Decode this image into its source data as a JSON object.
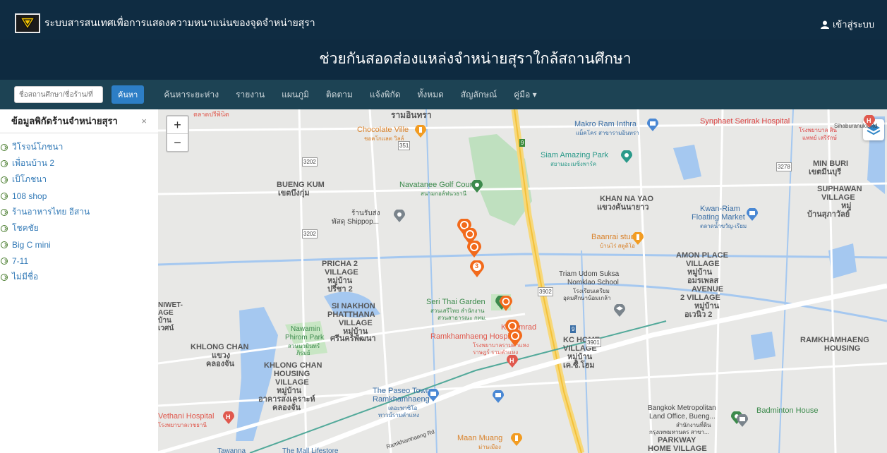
{
  "header": {
    "site_title": "ระบบสารสนเทศเพื่อการแสดงความหนาแน่นของจุดจำหน่ายสุรา",
    "login_label": "เข้าสู่ระบบ",
    "hero_text": "ช่วยกันสอดส่องแหล่งจำหน่ายสุราใกล้สถานศึกษา"
  },
  "navbar": {
    "search_placeholder": "ชื่อสถานศึกษา/ชื่อร้าน/ที่",
    "search_button": "ค้นหา",
    "menu": [
      "ค้นหาระยะห่าง",
      "รายงาน",
      "แผนภูมิ",
      "ติดตาม",
      "แจ้งพิกัด",
      "ทั้งหมด",
      "สัญลักษณ์",
      "คู่มือ ▾"
    ]
  },
  "sidebar": {
    "title": "ข้อมูลพิกัดร้านจำหน่ายสุรา",
    "close": "×",
    "shops": [
      "วีโรจน์โภชนา",
      "เพื่อนบ้าน 2",
      "เป็โภชนา",
      "108 shop",
      "ร้านอาหารไทย อีสาน",
      "โชคชัย",
      "Big C mini",
      "7-11",
      "ไม่มีชื่อ"
    ]
  },
  "map": {
    "zoom_in": "+",
    "zoom_out": "−",
    "labels": {
      "ram_inthra": "รามอินทรา",
      "talad_pri_pinit": "ตลาดปรีพินิต",
      "chocolate_ville": "Chocolate Ville",
      "chocolate_ville_th": "ชอคโกแลต วิลล์",
      "makro": "Makro Ram Inthra",
      "makro_th": "แม็คโคร สาขารามอินทรา",
      "synphaet": "Synphaet Serirak Hospital",
      "synphaet_th": "โรงพยาบาล สินแพทย์ เสรีรักษ์",
      "sihaburanukit": "Sihaburanukit Rd",
      "siam_amazing": "Siam Amazing Park",
      "siam_amazing_th": "สยามอะเมซิ่งพาร์ค",
      "min_buri": "MIN BURI",
      "min_buri_th": "เขตมีนบุรี",
      "bueng_kum": "BUENG KUM",
      "bueng_kum_th": "เขตบึงกุ่ม",
      "navatanee": "Navatanee Golf Course",
      "navatanee_th": "สนามกอล์ฟนวธานี",
      "khan_na_yao": "KHAN NA YAO",
      "khan_na_yao_th": "แขวงคันนายาว",
      "suphawan": "SUPHAWAN",
      "village": "VILLAGE",
      "suphawan_th1": "หมู่",
      "suphawan_th2": "บ้านสุภาวัลย์",
      "shippop_th": "ร้านรับส่ง",
      "shippop": "พัสดุ Shippop...",
      "kwan_riam": "Kwan-Riam",
      "floating_market": "Floating Market",
      "kwan_riam_th": "ตลาดน้ำขวัญ-เรียม",
      "baanrai": "Baanrai studio",
      "baanrai_th": "บ้านไร่ สตูดิโอ",
      "amon_place": "AMON PLACE",
      "amon_th1": "หมู่บ้าน",
      "amon_th2": "อมรเพลส",
      "pricha2": "PRICHA 2",
      "pricha_th1": "หมู่บ้าน",
      "pricha_th2": "ปรีชา 2",
      "triam_udom": "Triam Udom Suksa",
      "nomklao": "Nomklao School",
      "triam_th1": "โรงเรียนเตรียม",
      "triam_th2": "อุดมศึกษาน้อมเกล้า",
      "avenue": "AVENUE",
      "avenue_village": "2 VILLAGE",
      "avenue_th1": "หมู่บ้าน",
      "avenue_th2": "อเวนิว 2",
      "niwet": "NIWET-",
      "niwet_age": "AGE",
      "niwet_th1": "บ้าน",
      "niwet_th2": "เวศน์",
      "si_nakhon": "SI NAKHON",
      "phatthana": "PHATTHANA",
      "si_nakhon_th1": "หมู่บ้าน",
      "si_nakhon_th2": "ศรีนครพัฒนา",
      "seri_thai": "Seri Thai Garden",
      "seri_thai_th1": "สวนเสรีไทย สำนักงาน",
      "seri_thai_th2": "สวนสาธารณะ กทม.",
      "kasem_rad": "Kasemrad",
      "ramkhamhaeng_hosp": "Ramkhamhaeng Hospital",
      "ramkhamhaeng_hosp_th1": "โรงพยาบาลรามคำแหง",
      "ramkhamhaeng_hosp_th2": "ราษฎร์ รามคำแหง",
      "nawamin": "Nawamin",
      "phirom_park": "Phirom Park",
      "nawamin_th1": "สวนนวมินทร์",
      "nawamin_th2": "ภิรมย์",
      "khlong_chan": "KHLONG CHAN",
      "khlong_chan_th1": "แขวง",
      "khlong_chan_th2": "คลองจั่น",
      "kc_home": "KC HOME",
      "kc_village": "VILLAGE",
      "kc_th1": "หมู่บ้าน",
      "kc_th2": "เค.ซี.โฮม",
      "ramkhamhaeng_housing1": "RAMKHAMHAENG",
      "ramkhamhaeng_housing2": "HOUSING",
      "kc_housing1": "KHLONG CHAN",
      "kc_housing2": "HOUSING",
      "kc_housing3": "VILLAGE",
      "kc_housing_th1": "หมู่บ้าน",
      "kc_housing_th2": "อาคารสงเคราะห์",
      "kc_housing_th3": "คลองจั่น",
      "paseo": "The Paseo Town",
      "paseo2": "Ramkhamhaeng",
      "paseo_th1": "เดอะพาซิโอ",
      "paseo_th2": "ทาวน์รามคำแหง",
      "vethani": "Vethani Hospital",
      "vethani_th": "โรงพยาบาลเวชธานี",
      "bangkok_metro": "Bangkok Metropolitan",
      "land_office": "Land Office, Bueng...",
      "land_office_th1": "สำนักงานที่ดิน",
      "land_office_th2": "กรุงเทพมหานคร สาขา...",
      "badminton": "Badminton House",
      "parkway": "PARKWAY",
      "home_village": "HOME VILLAGE",
      "maan_muang": "Maan Muang",
      "maan_muang_th": "ม่านเมือง",
      "tawanna": "Tawanna",
      "mall_lifestore": "The Mall Lifestore",
      "ramkhamhaeng_rd": "Ramkhamhaeng Rd",
      "road_3202": "3202",
      "road_351": "351",
      "road_3278": "3278",
      "road_3902": "3902",
      "road_3901": "3901",
      "road_9": "9",
      "cluster_number": "3"
    }
  },
  "colors": {
    "topbar": "#0f2c42",
    "navbar": "#1d4354",
    "search_button": "#2d7ec6",
    "sidebar_link": "#337ab7",
    "marker": "#f26a1b",
    "hospital": "#e0584d",
    "water": "#a5c8f0",
    "park": "#bfe0bf"
  },
  "icons": [
    "logo-icon",
    "user-icon",
    "plus-circle-icon",
    "layers-icon",
    "location-pin-icon",
    "hospital-icon",
    "restaurant-icon",
    "park-icon",
    "shopping-icon",
    "school-icon"
  ]
}
